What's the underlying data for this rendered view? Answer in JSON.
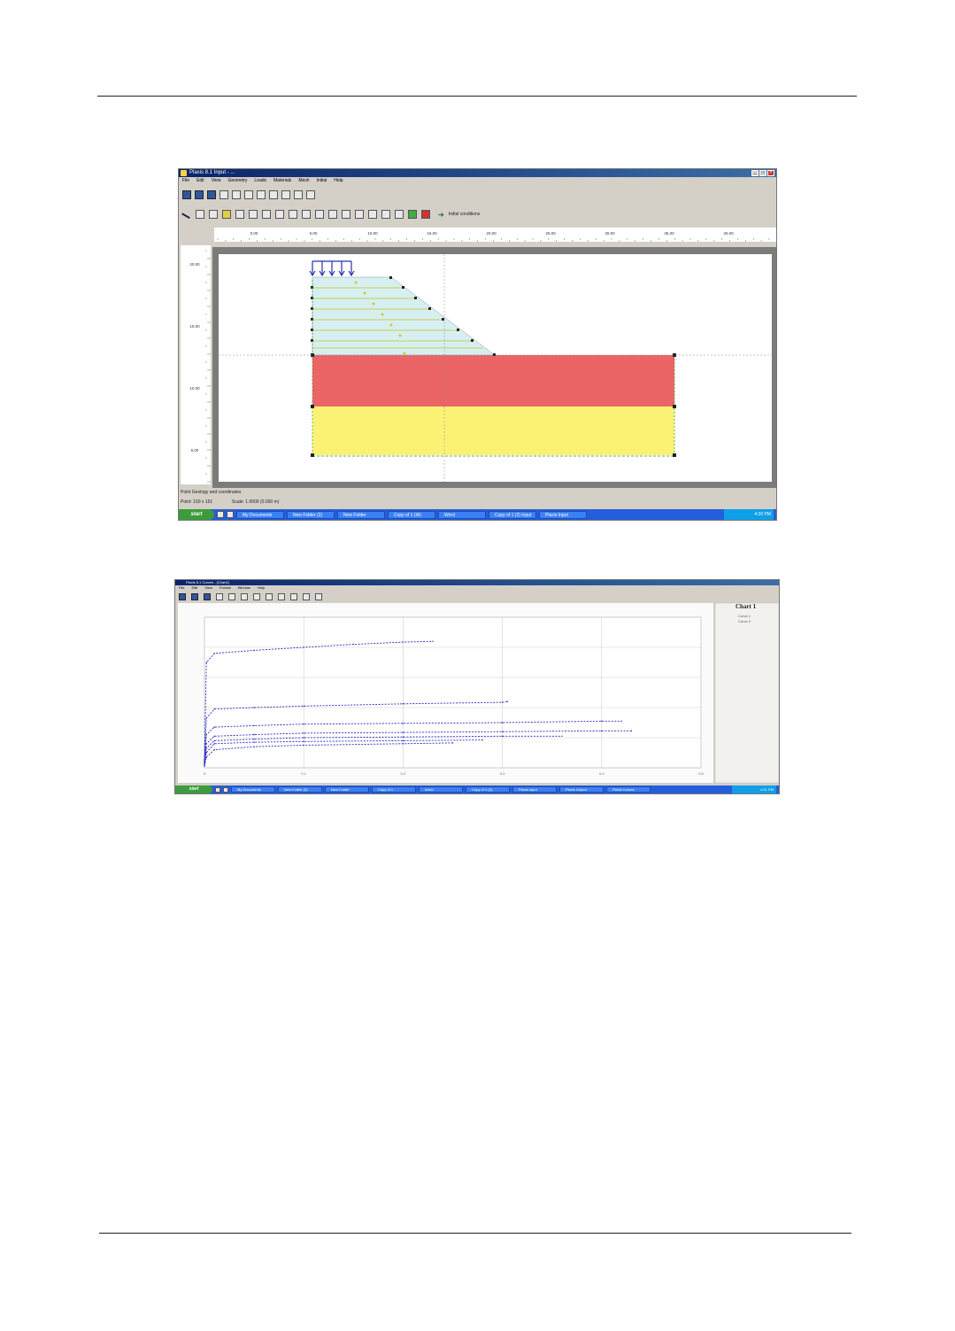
{
  "screenshot_input": {
    "window_title": "Plaxis 8.1 Input - ...",
    "menu": [
      "File",
      "Edit",
      "View",
      "Geometry",
      "Loads",
      "Materials",
      "Mesh",
      "Initial",
      "Help"
    ],
    "tool_label": "Initial conditions",
    "status_line": "Point Geology and coordinates",
    "status_coords": "Point: 150 x 151",
    "status_scale": "Scale: 1.0000 (0.000 m)",
    "x_ruler_ticks": [
      "0.00",
      "5.00",
      "10.00",
      "15.00",
      "20.00",
      "25.00",
      "30.00",
      "35.00",
      "40.00"
    ],
    "y_ruler_ticks": [
      "20.00",
      "15.00",
      "10.00",
      "5.00"
    ],
    "taskbar_start": "start",
    "taskbar_items": [
      "My Documents",
      "New Folder (2)",
      "New Folder",
      "Copy of 1 (IA)",
      "Word",
      "Copy of 1 (2) Input",
      "Plaxis Input"
    ],
    "clock": "4:30 PM",
    "colors": {
      "layer_top": "#ec6566",
      "layer_bottom": "#fbf275",
      "embankment": "#d6f0f2",
      "load": "#2233aa"
    }
  },
  "screenshot_curves": {
    "window_title": "Plaxis 8.1 Curves - [Chart1]",
    "menu": [
      "File",
      "Edit",
      "View",
      "Format",
      "Window",
      "Help"
    ],
    "chart_title": "Chart 1",
    "legend": [
      "Curve 1",
      "Curve 2"
    ],
    "taskbar_start": "start",
    "taskbar_items": [
      "My Documents",
      "New Folder (2)",
      "New Folder",
      "Copy of 1",
      "Word",
      "Copy of 1 (2)",
      "Plaxis Input",
      "Plaxis Output",
      "Plaxis Curves"
    ],
    "clock": "4:31 PM"
  },
  "chart_data": {
    "type": "line",
    "title": "Chart 1",
    "xlim": [
      0,
      0.5
    ],
    "ylim": [
      0,
      1.0
    ],
    "x_ticks": [
      "0",
      "0.1",
      "0.2",
      "0.3",
      "0.4",
      "0.5"
    ],
    "grid": true,
    "series": [
      {
        "values": [
          [
            0,
            0.05
          ],
          [
            0.002,
            0.7
          ],
          [
            0.01,
            0.76
          ],
          [
            0.05,
            0.78
          ],
          [
            0.1,
            0.8
          ],
          [
            0.15,
            0.82
          ],
          [
            0.2,
            0.835
          ],
          [
            0.23,
            0.84
          ]
        ]
      },
      {
        "values": [
          [
            0,
            0.04
          ],
          [
            0.002,
            0.33
          ],
          [
            0.01,
            0.39
          ],
          [
            0.05,
            0.4
          ],
          [
            0.1,
            0.41
          ],
          [
            0.2,
            0.425
          ],
          [
            0.3,
            0.435
          ],
          [
            0.305,
            0.44
          ]
        ]
      },
      {
        "values": [
          [
            0,
            0.03
          ],
          [
            0.002,
            0.22
          ],
          [
            0.01,
            0.27
          ],
          [
            0.05,
            0.28
          ],
          [
            0.1,
            0.29
          ],
          [
            0.2,
            0.295
          ],
          [
            0.3,
            0.3
          ],
          [
            0.4,
            0.31
          ],
          [
            0.42,
            0.31
          ]
        ]
      },
      {
        "values": [
          [
            0,
            0.03
          ],
          [
            0.002,
            0.16
          ],
          [
            0.01,
            0.21
          ],
          [
            0.05,
            0.22
          ],
          [
            0.1,
            0.23
          ],
          [
            0.2,
            0.235
          ],
          [
            0.3,
            0.24
          ],
          [
            0.4,
            0.245
          ],
          [
            0.43,
            0.245
          ]
        ]
      },
      {
        "values": [
          [
            0,
            0.02
          ],
          [
            0.002,
            0.13
          ],
          [
            0.01,
            0.18
          ],
          [
            0.05,
            0.19
          ],
          [
            0.1,
            0.2
          ],
          [
            0.2,
            0.205
          ],
          [
            0.3,
            0.21
          ],
          [
            0.36,
            0.21
          ]
        ]
      },
      {
        "values": [
          [
            0,
            0.02
          ],
          [
            0.002,
            0.1
          ],
          [
            0.01,
            0.16
          ],
          [
            0.05,
            0.17
          ],
          [
            0.1,
            0.175
          ],
          [
            0.2,
            0.18
          ],
          [
            0.28,
            0.185
          ]
        ]
      },
      {
        "values": [
          [
            0,
            0.01
          ],
          [
            0.002,
            0.07
          ],
          [
            0.01,
            0.12
          ],
          [
            0.05,
            0.14
          ],
          [
            0.1,
            0.15
          ],
          [
            0.2,
            0.16
          ],
          [
            0.25,
            0.165
          ]
        ]
      }
    ]
  }
}
